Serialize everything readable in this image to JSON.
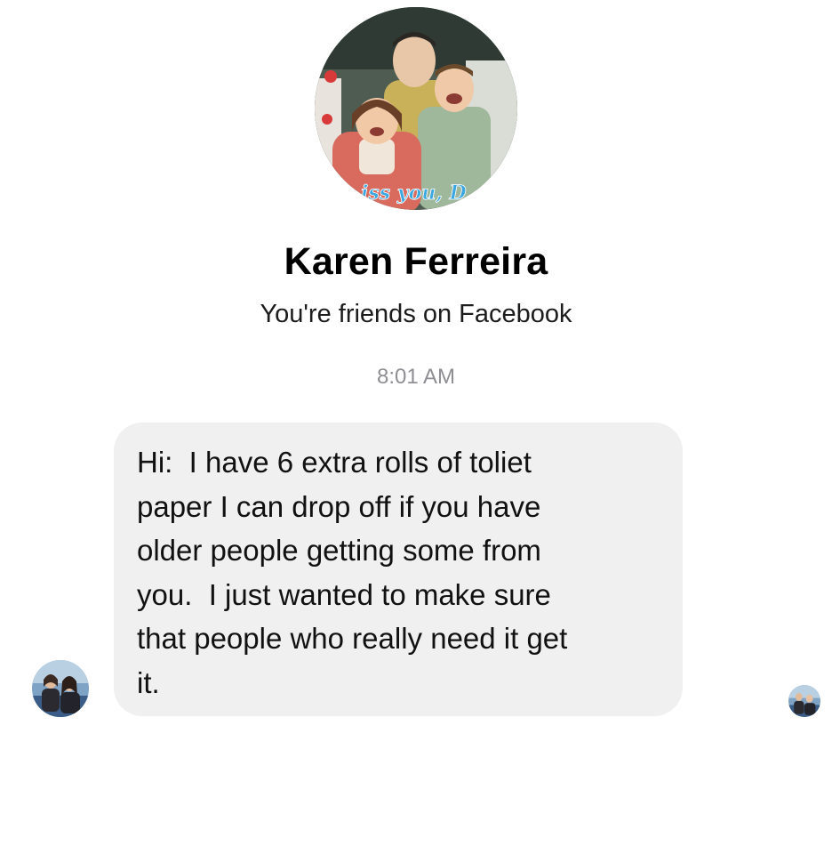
{
  "conversation": {
    "contact_name": "Karen Ferreira",
    "friend_status": "You're friends on Facebook",
    "timestamp": "8:01 AM",
    "profile_photo_overlay_text": "iss you, D",
    "message": {
      "lines": [
        "Hi:  I have 6 extra rolls of toliet",
        "paper I can drop off if you have",
        "older people getting some from",
        "you.  I just wanted to make sure",
        "that people who really need it get",
        "it."
      ]
    }
  },
  "icons": {
    "profile_photo": "family-photo",
    "sender_avatar": "user-avatar",
    "seen_indicator": "seen-avatar-icon"
  },
  "colors": {
    "bubble_background": "#f0f0f0",
    "timestamp_text": "#8e8e93",
    "overlay_text": "#3aa7e0"
  }
}
